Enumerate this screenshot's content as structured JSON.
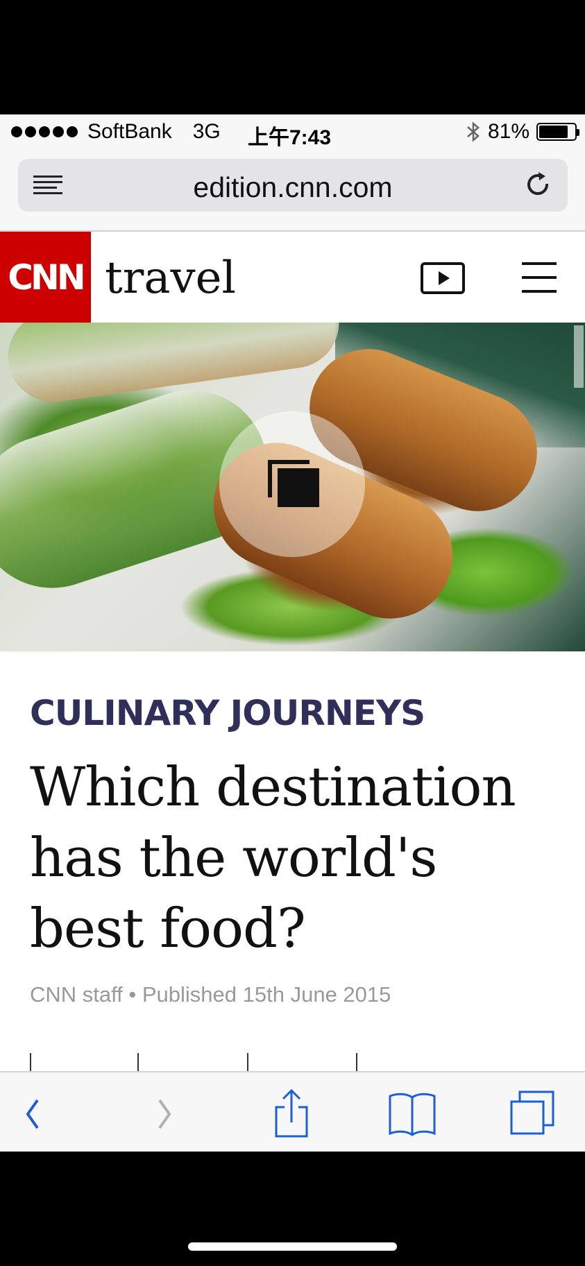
{
  "status_bar": {
    "carrier": "SoftBank",
    "network": "3G",
    "time": "上午7:43",
    "battery": "81%",
    "battery_level": 0.81
  },
  "browser": {
    "url": "edition.cnn.com"
  },
  "site": {
    "logo": "CNN",
    "section": "travel"
  },
  "article": {
    "kicker": "CULINARY JOURNEYS",
    "headline": "Which destination has the world's best food?",
    "byline": "CNN staff • Published 15th June 2015"
  },
  "colors": {
    "cnn_red": "#cc0000",
    "kicker": "#2f2f5a",
    "ios_blue": "#1a5fd6"
  }
}
